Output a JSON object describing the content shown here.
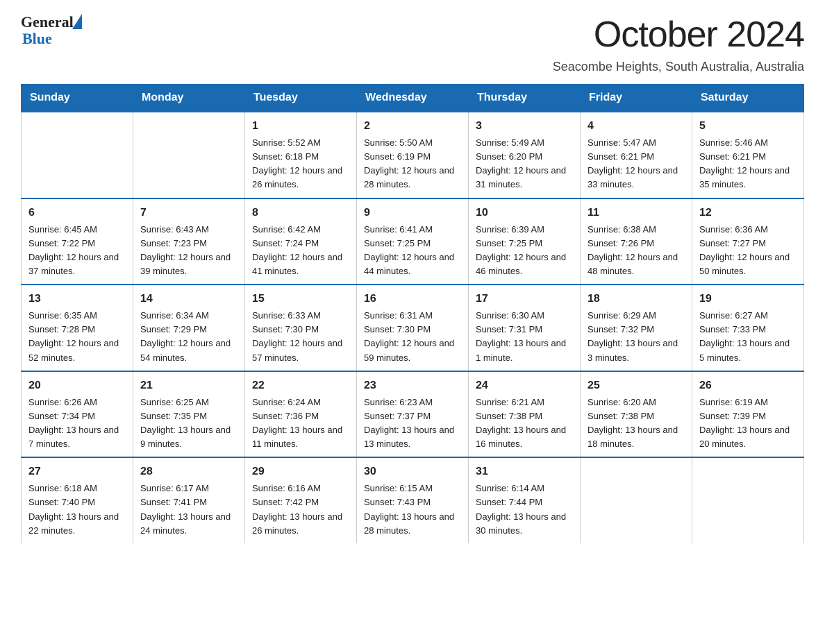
{
  "header": {
    "logo_general": "General",
    "logo_blue": "Blue",
    "title": "October 2024",
    "subtitle": "Seacombe Heights, South Australia, Australia"
  },
  "days_of_week": [
    "Sunday",
    "Monday",
    "Tuesday",
    "Wednesday",
    "Thursday",
    "Friday",
    "Saturday"
  ],
  "weeks": [
    [
      {
        "day": "",
        "sunrise": "",
        "sunset": "",
        "daylight": ""
      },
      {
        "day": "",
        "sunrise": "",
        "sunset": "",
        "daylight": ""
      },
      {
        "day": "1",
        "sunrise": "Sunrise: 5:52 AM",
        "sunset": "Sunset: 6:18 PM",
        "daylight": "Daylight: 12 hours and 26 minutes."
      },
      {
        "day": "2",
        "sunrise": "Sunrise: 5:50 AM",
        "sunset": "Sunset: 6:19 PM",
        "daylight": "Daylight: 12 hours and 28 minutes."
      },
      {
        "day": "3",
        "sunrise": "Sunrise: 5:49 AM",
        "sunset": "Sunset: 6:20 PM",
        "daylight": "Daylight: 12 hours and 31 minutes."
      },
      {
        "day": "4",
        "sunrise": "Sunrise: 5:47 AM",
        "sunset": "Sunset: 6:21 PM",
        "daylight": "Daylight: 12 hours and 33 minutes."
      },
      {
        "day": "5",
        "sunrise": "Sunrise: 5:46 AM",
        "sunset": "Sunset: 6:21 PM",
        "daylight": "Daylight: 12 hours and 35 minutes."
      }
    ],
    [
      {
        "day": "6",
        "sunrise": "Sunrise: 6:45 AM",
        "sunset": "Sunset: 7:22 PM",
        "daylight": "Daylight: 12 hours and 37 minutes."
      },
      {
        "day": "7",
        "sunrise": "Sunrise: 6:43 AM",
        "sunset": "Sunset: 7:23 PM",
        "daylight": "Daylight: 12 hours and 39 minutes."
      },
      {
        "day": "8",
        "sunrise": "Sunrise: 6:42 AM",
        "sunset": "Sunset: 7:24 PM",
        "daylight": "Daylight: 12 hours and 41 minutes."
      },
      {
        "day": "9",
        "sunrise": "Sunrise: 6:41 AM",
        "sunset": "Sunset: 7:25 PM",
        "daylight": "Daylight: 12 hours and 44 minutes."
      },
      {
        "day": "10",
        "sunrise": "Sunrise: 6:39 AM",
        "sunset": "Sunset: 7:25 PM",
        "daylight": "Daylight: 12 hours and 46 minutes."
      },
      {
        "day": "11",
        "sunrise": "Sunrise: 6:38 AM",
        "sunset": "Sunset: 7:26 PM",
        "daylight": "Daylight: 12 hours and 48 minutes."
      },
      {
        "day": "12",
        "sunrise": "Sunrise: 6:36 AM",
        "sunset": "Sunset: 7:27 PM",
        "daylight": "Daylight: 12 hours and 50 minutes."
      }
    ],
    [
      {
        "day": "13",
        "sunrise": "Sunrise: 6:35 AM",
        "sunset": "Sunset: 7:28 PM",
        "daylight": "Daylight: 12 hours and 52 minutes."
      },
      {
        "day": "14",
        "sunrise": "Sunrise: 6:34 AM",
        "sunset": "Sunset: 7:29 PM",
        "daylight": "Daylight: 12 hours and 54 minutes."
      },
      {
        "day": "15",
        "sunrise": "Sunrise: 6:33 AM",
        "sunset": "Sunset: 7:30 PM",
        "daylight": "Daylight: 12 hours and 57 minutes."
      },
      {
        "day": "16",
        "sunrise": "Sunrise: 6:31 AM",
        "sunset": "Sunset: 7:30 PM",
        "daylight": "Daylight: 12 hours and 59 minutes."
      },
      {
        "day": "17",
        "sunrise": "Sunrise: 6:30 AM",
        "sunset": "Sunset: 7:31 PM",
        "daylight": "Daylight: 13 hours and 1 minute."
      },
      {
        "day": "18",
        "sunrise": "Sunrise: 6:29 AM",
        "sunset": "Sunset: 7:32 PM",
        "daylight": "Daylight: 13 hours and 3 minutes."
      },
      {
        "day": "19",
        "sunrise": "Sunrise: 6:27 AM",
        "sunset": "Sunset: 7:33 PM",
        "daylight": "Daylight: 13 hours and 5 minutes."
      }
    ],
    [
      {
        "day": "20",
        "sunrise": "Sunrise: 6:26 AM",
        "sunset": "Sunset: 7:34 PM",
        "daylight": "Daylight: 13 hours and 7 minutes."
      },
      {
        "day": "21",
        "sunrise": "Sunrise: 6:25 AM",
        "sunset": "Sunset: 7:35 PM",
        "daylight": "Daylight: 13 hours and 9 minutes."
      },
      {
        "day": "22",
        "sunrise": "Sunrise: 6:24 AM",
        "sunset": "Sunset: 7:36 PM",
        "daylight": "Daylight: 13 hours and 11 minutes."
      },
      {
        "day": "23",
        "sunrise": "Sunrise: 6:23 AM",
        "sunset": "Sunset: 7:37 PM",
        "daylight": "Daylight: 13 hours and 13 minutes."
      },
      {
        "day": "24",
        "sunrise": "Sunrise: 6:21 AM",
        "sunset": "Sunset: 7:38 PM",
        "daylight": "Daylight: 13 hours and 16 minutes."
      },
      {
        "day": "25",
        "sunrise": "Sunrise: 6:20 AM",
        "sunset": "Sunset: 7:38 PM",
        "daylight": "Daylight: 13 hours and 18 minutes."
      },
      {
        "day": "26",
        "sunrise": "Sunrise: 6:19 AM",
        "sunset": "Sunset: 7:39 PM",
        "daylight": "Daylight: 13 hours and 20 minutes."
      }
    ],
    [
      {
        "day": "27",
        "sunrise": "Sunrise: 6:18 AM",
        "sunset": "Sunset: 7:40 PM",
        "daylight": "Daylight: 13 hours and 22 minutes."
      },
      {
        "day": "28",
        "sunrise": "Sunrise: 6:17 AM",
        "sunset": "Sunset: 7:41 PM",
        "daylight": "Daylight: 13 hours and 24 minutes."
      },
      {
        "day": "29",
        "sunrise": "Sunrise: 6:16 AM",
        "sunset": "Sunset: 7:42 PM",
        "daylight": "Daylight: 13 hours and 26 minutes."
      },
      {
        "day": "30",
        "sunrise": "Sunrise: 6:15 AM",
        "sunset": "Sunset: 7:43 PM",
        "daylight": "Daylight: 13 hours and 28 minutes."
      },
      {
        "day": "31",
        "sunrise": "Sunrise: 6:14 AM",
        "sunset": "Sunset: 7:44 PM",
        "daylight": "Daylight: 13 hours and 30 minutes."
      },
      {
        "day": "",
        "sunrise": "",
        "sunset": "",
        "daylight": ""
      },
      {
        "day": "",
        "sunrise": "",
        "sunset": "",
        "daylight": ""
      }
    ]
  ]
}
